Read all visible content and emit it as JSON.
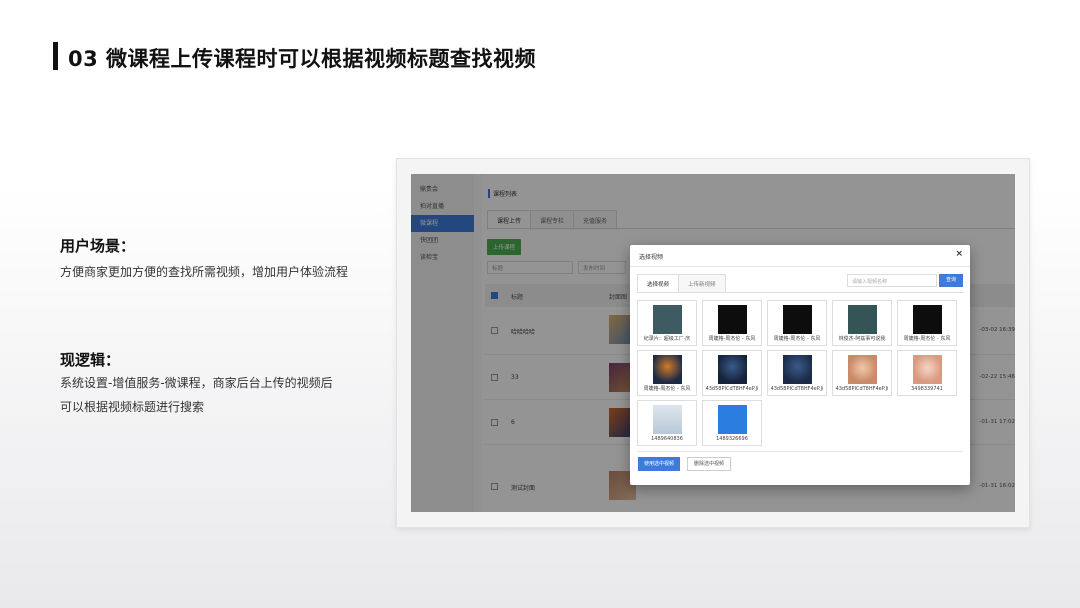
{
  "page": {
    "title": "03 微课程上传课程时可以根据视频标题查找视频",
    "scenario_title": "用户场景：",
    "scenario_text": "方便商家更加方便的查找所需视频，增加用户体验流程",
    "logic_title": "现逻辑：",
    "logic_line1": "系统设置-增值服务-微课程，商家后台上传的视频后",
    "logic_line2": "可以根据视频标题进行搜索"
  },
  "app": {
    "sidebar": [
      "鼎贵会",
      "拍对直播",
      "微课程",
      "快团团",
      "读检宝"
    ],
    "breadcrumb": "课程列表",
    "tabs": [
      "课程上传",
      "课程专栏",
      "充值服务"
    ],
    "upload_button": "上传课程",
    "filter_title_placeholder": "标题",
    "filter_date_placeholder": "发布时间",
    "columns": [
      "标题",
      "封面图"
    ],
    "rows": [
      {
        "title": "哈哈哈哈",
        "date": "-03-02 16:39"
      },
      {
        "title": "33",
        "date": "-02-22 15:46"
      },
      {
        "title": "6",
        "date": "-01-31 17:02"
      },
      {
        "title": "测试封面",
        "date": "-01-31 16:02"
      }
    ]
  },
  "dialog": {
    "title": "选择视频",
    "close": "×",
    "tabs": [
      "选择视频",
      "上传新视频"
    ],
    "search_placeholder": "请输入视频名称",
    "search_button": "查询",
    "videos": [
      {
        "caption": "纪录片：超级工厂·庆",
        "color": "#3e5a63"
      },
      {
        "caption": "周婕格-周杰伦 - 东风",
        "color": "#0d0d0d"
      },
      {
        "caption": "周婕格-周杰伦 - 东风",
        "color": "#0d0d0d"
      },
      {
        "caption": "林俊杰-阿兹事可说我",
        "color": "#355455"
      },
      {
        "caption": "周婕格-周杰伦 - 东风",
        "color": "#0d0d0d"
      },
      {
        "caption": "周婕格-周杰伦 - 东风",
        "color": "#1c2a45"
      },
      {
        "caption": "43d58PICdT8HF4eP.Ji",
        "color": "#14223a"
      },
      {
        "caption": "43d58PICdT8HF4eP.Ji",
        "color": "#1b2b47"
      },
      {
        "caption": "43d58PICdT8HF4eP.Ji",
        "color": "#c98a6a"
      },
      {
        "caption": "3498339741",
        "color": "#d99a82"
      },
      {
        "caption": "1489640836",
        "color": "#dde6ee"
      },
      {
        "caption": "1489326696",
        "color": "#2c7de0"
      }
    ],
    "use_button": "使用选中视频",
    "delete_button": "删除选中视频"
  }
}
